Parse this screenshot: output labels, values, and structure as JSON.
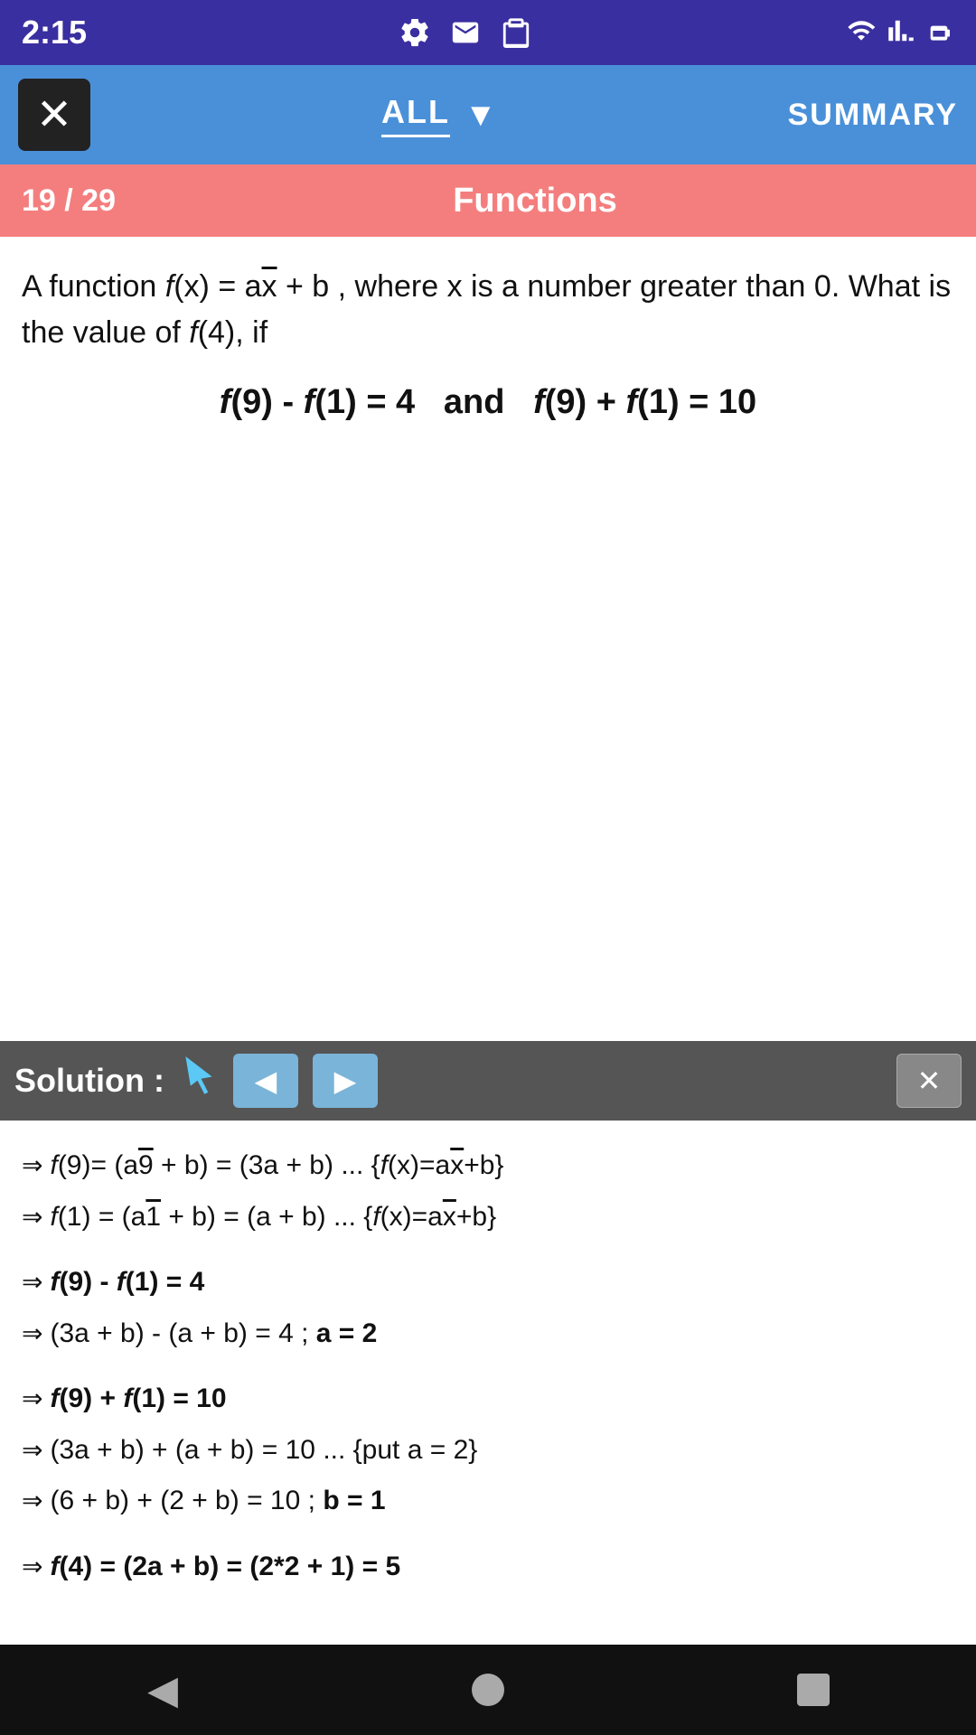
{
  "statusBar": {
    "time": "2:15",
    "icons": [
      "gear-icon",
      "mail-icon",
      "clipboard-icon"
    ],
    "rightIcons": [
      "wifi-icon",
      "signal-icon",
      "battery-icon"
    ]
  },
  "navBar": {
    "closeLabel": "✕",
    "allLabel": "ALL",
    "dropdownArrow": "▼",
    "summaryLabel": "SUMMARY"
  },
  "progressBar": {
    "count": "19 / 29",
    "title": "Functions"
  },
  "question": {
    "text1": "A function f(x) = a",
    "sqrtX": "x",
    "text2": " + b , where x is a number greater than 0. What is the value of f(4), if",
    "formula": "f(9) - f(1) = 4  and  f(9) + f(1) = 10"
  },
  "solution": {
    "label": "Solution :",
    "cursorIcon": "🖱",
    "prevArrow": "◀",
    "nextArrow": "▶",
    "closeLabel": "✕",
    "lines": [
      {
        "arrow": "⇒",
        "text": "f(9)= (a√9 + b) = (3a + b) ... {f(x)=a√x+b}",
        "bold": false
      },
      {
        "arrow": "⇒",
        "text": "f(1) = (a√1 + b) = (a + b) ... {f(x)=a√x+b}",
        "bold": false
      },
      {
        "arrow": "⇒",
        "text": "f(9) - f(1) = 4",
        "bold": true
      },
      {
        "arrow": "⇒",
        "text": "(3a + b) - (a + b) = 4 ;  a = 2",
        "bold": false
      },
      {
        "arrow": "⇒",
        "text": "f(9) + f(1) = 10",
        "bold": true
      },
      {
        "arrow": "⇒",
        "text": "(3a + b) + (a + b) = 10 ... {put a = 2}",
        "bold": false
      },
      {
        "arrow": "⇒",
        "text": "(6 + b) + (2 + b) = 10 ;  b = 1",
        "bold": false
      },
      {
        "arrow": "⇒",
        "text": "f(4) = (2a + b) = (2*2 + 1) = 5",
        "bold": true
      }
    ]
  },
  "bottomNav": {
    "backArrow": "◀",
    "homeCircle": "●",
    "recentSquare": "■"
  }
}
